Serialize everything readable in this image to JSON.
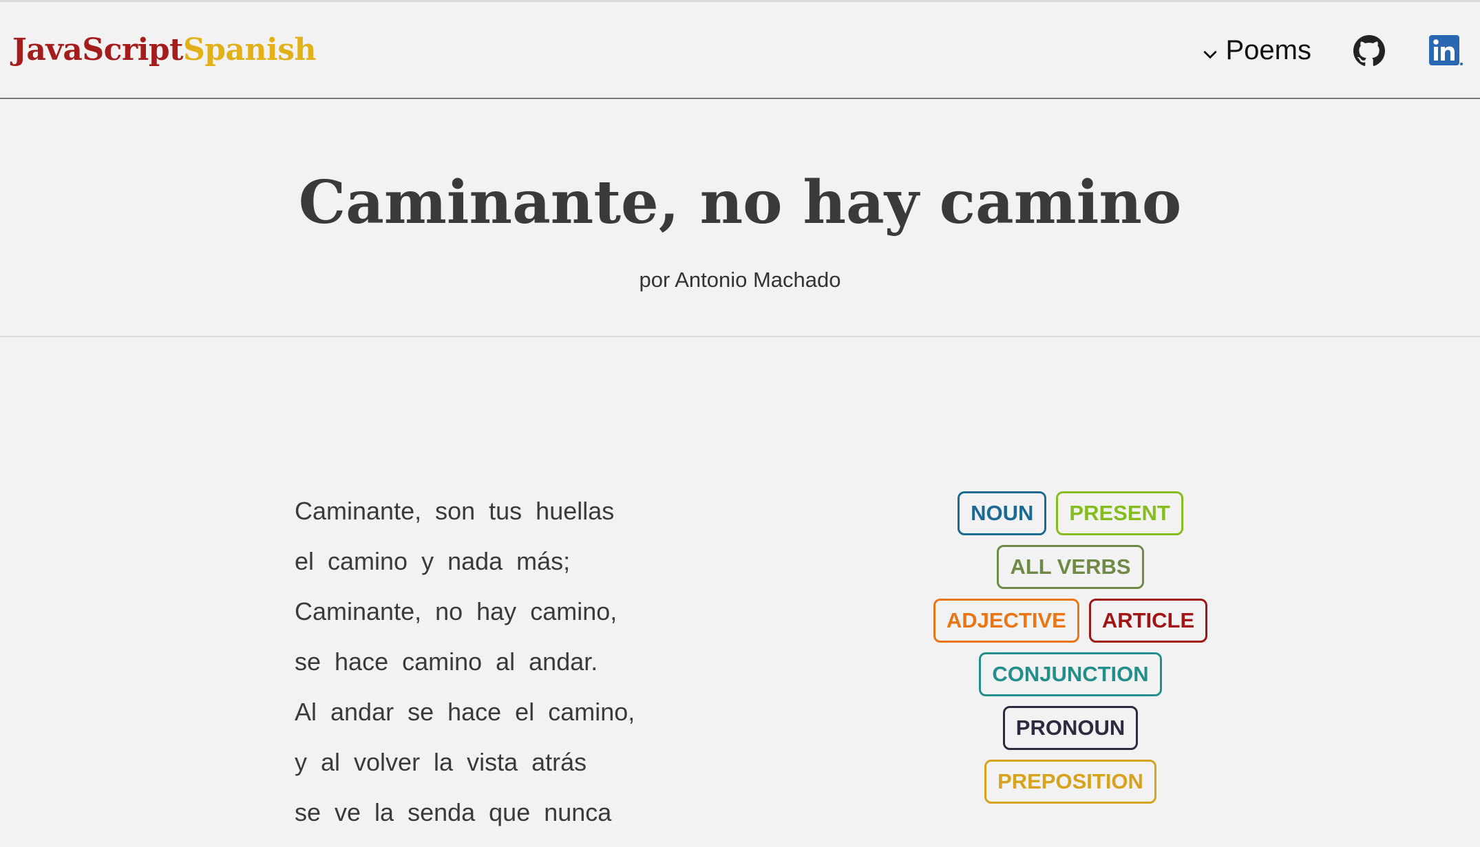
{
  "header": {
    "logo_part1": "JavaScript",
    "logo_part2": "Spanish",
    "logo_color1": "#a51c1c",
    "logo_color2": "#e2b019",
    "nav_poems_label": "Poems",
    "icons": [
      "chevron-down-icon",
      "github-icon",
      "linkedin-icon"
    ]
  },
  "hero": {
    "title": "Caminante, no hay camino",
    "subtitle": "por Antonio Machado"
  },
  "poem": {
    "lines": [
      "Caminante, son tus huellas",
      "el camino y nada más;",
      "Caminante, no hay camino,",
      "se hace camino al andar.",
      "Al andar se hace el camino,",
      "y al volver la vista atrás",
      "se ve la senda que nunca"
    ]
  },
  "tags": [
    {
      "label": "NOUN",
      "color": "#1c6a94"
    },
    {
      "label": "PRESENT",
      "color": "#86bd1e"
    },
    {
      "label": "ALL VERBS",
      "color": "#6f8a46"
    },
    {
      "label": "ADJECTIVE",
      "color": "#ea7514"
    },
    {
      "label": "ARTICLE",
      "color": "#a01616"
    },
    {
      "label": "CONJUNCTION",
      "color": "#238f8a"
    },
    {
      "label": "PRONOUN",
      "color": "#2e2a40"
    },
    {
      "label": "PREPOSITION",
      "color": "#d7a21c"
    }
  ]
}
